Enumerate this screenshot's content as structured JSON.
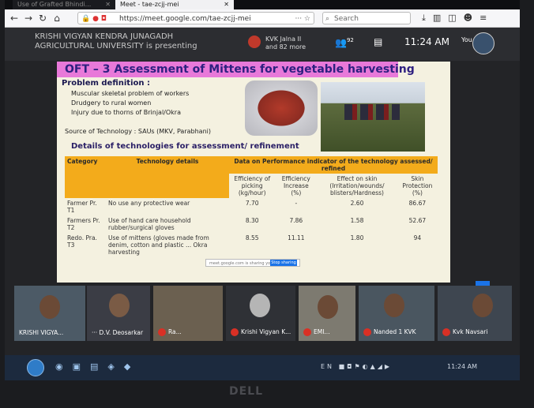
{
  "browser": {
    "inactive_tab": "Use of Grafted Bhindi...",
    "active_tab": "Meet - tae-zcjj-mei",
    "url": "https://meet.google.com/tae-zcjj-mei",
    "search_placeholder": "Search"
  },
  "meet": {
    "presenting_line1": "KRISHI VIGYAN KENDRA JUNAGADH",
    "presenting_line2": "AGRICULTURAL UNIVERSITY is presenting",
    "pinned_line1": "KVK Jalna II",
    "pinned_line2": "and 82 more",
    "people_count": "92",
    "time": "11:24 AM",
    "self_label": "You"
  },
  "slide": {
    "title": "OFT – 3  Assessment of Mittens for vegetable harvesting",
    "problem_heading": "Problem definition :",
    "problems": [
      "Muscular skeletal problem of workers",
      "Drudgery to rural women",
      "Injury due to thorns of Brinjal/Okra"
    ],
    "source": "Source of Technology : SAUs (MKV, Parabhani)",
    "details_heading": "Details of technologies for assessment/ refinement",
    "table": {
      "h_category": "Category",
      "h_tech": "Technology details",
      "h_data": "Data on Performance indicator of the technology assessed/ refined",
      "sub": [
        "Efficiency of picking (kg/hour)",
        "Efficiency Increase (%)",
        "Effect on skin (Irritation/wounds/ blisters/Hardness)",
        "Skin Protection (%)"
      ],
      "rows": [
        {
          "cat": "Farmer Pr. T1",
          "tech": "No use any protective wear",
          "v1": "7.70",
          "v2": "-",
          "v3": "2.60",
          "v4": "86.67"
        },
        {
          "cat": "Farmers Pr. T2",
          "tech": "Use of hand care household rubber/surgical gloves",
          "v1": "8.30",
          "v2": "7.86",
          "v3": "1.58",
          "v4": "52.67"
        },
        {
          "cat": "Redo. Pra. T3",
          "tech": "Use of mittens (gloves made from denim, cotton and plastic ... Okra harvesting",
          "v1": "8.55",
          "v2": "11.11",
          "v3": "1.80",
          "v4": "94"
        }
      ]
    },
    "share_bar_text": "meet.google.com is sharing your window",
    "share_bar_button": "Stop sharing"
  },
  "participants": [
    {
      "name": "KRISHI VIGYA..."
    },
    {
      "name": "D.V. Deosarkar"
    },
    {
      "name": "Ra..."
    },
    {
      "name": "Krishi Vigyan K..."
    },
    {
      "name": "EMI..."
    },
    {
      "name": "Nanded 1 KVK"
    },
    {
      "name": "Kvk Navsari"
    }
  ],
  "taskbar": {
    "lang": "EN",
    "time": "11:24 AM"
  },
  "monitor_brand": "DELL"
}
